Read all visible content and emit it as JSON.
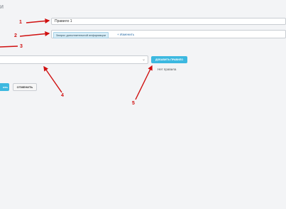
{
  "page": {
    "title_fragment": "и"
  },
  "form": {
    "rule_name_value": "Правило 1",
    "info_chip_label": "Запрос дополнительной информации",
    "change_link_label": "+ Изменить",
    "type_select_value": "",
    "add_rule_label": "ДОБАВИТЬ ПРАВИЛО",
    "no_rules_text": "Нет правила",
    "save_label": "ить",
    "cancel_label": "ОТМЕНИТЬ"
  },
  "annotations": {
    "callout_1": "1",
    "callout_2": "2",
    "callout_3": "3",
    "callout_4": "4",
    "callout_5": "5",
    "arrow_color": "#d01010"
  },
  "colors": {
    "accent": "#3cb8e0",
    "link": "#2b6ea8",
    "background": "#f3f4f6"
  }
}
